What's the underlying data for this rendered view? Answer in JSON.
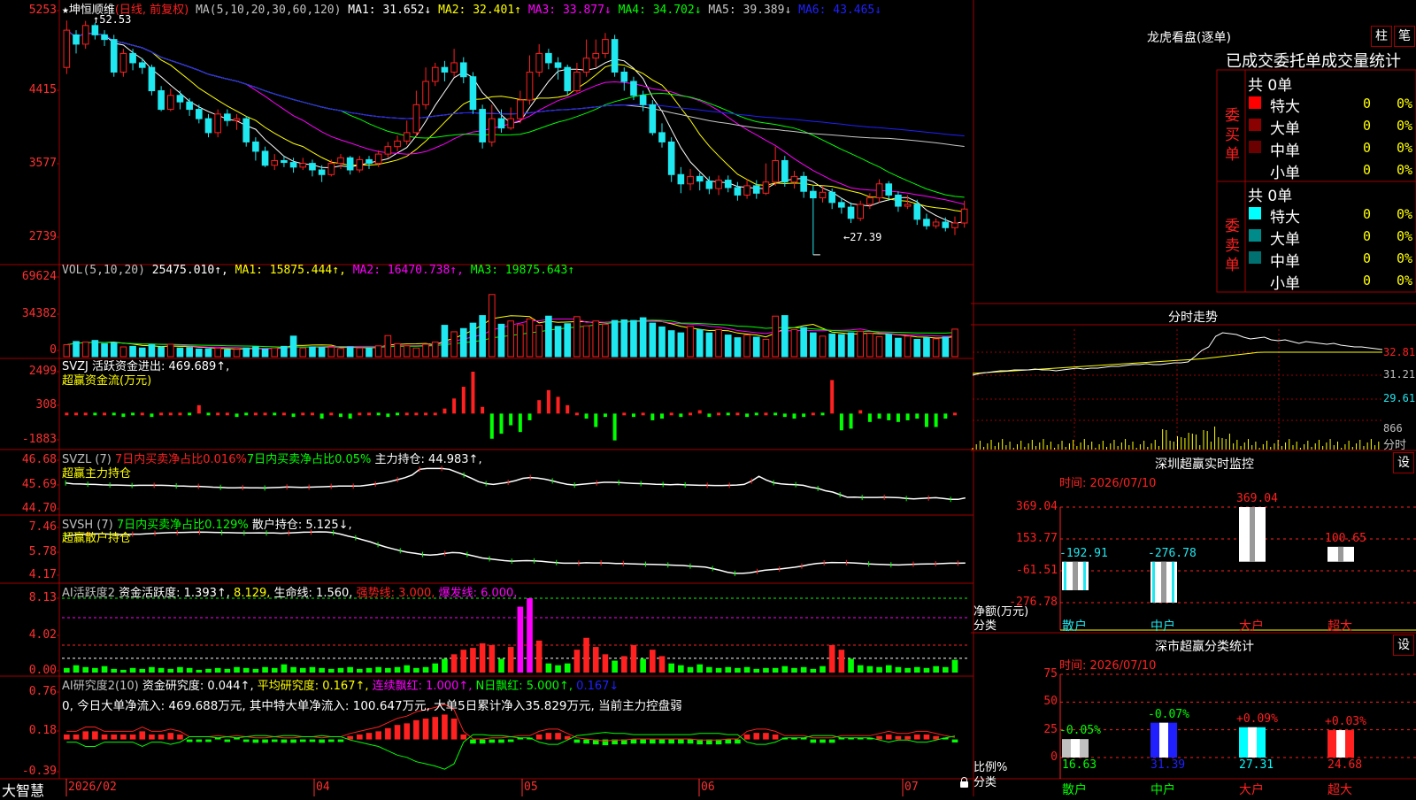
{
  "colors": {
    "up": "#ff2020",
    "down": "#20e8f0",
    "ma1": "#ffffff",
    "ma2": "#ffff00",
    "ma3": "#ff00ff",
    "ma4": "#00ff00",
    "ma5": "#c8c8c8",
    "ma6": "#2020ff",
    "grid": "#a00000"
  },
  "stock": {
    "title_star": "★",
    "name": "坤恒顺维",
    "mode": "(日线, 前复权)",
    "ma_params": "MA(5,10,20,30,60,120)",
    "ma": [
      {
        "label": "MA1:",
        "value": "31.652↓",
        "color": "#ffffff"
      },
      {
        "label": "MA2:",
        "value": "32.401↑",
        "color": "#ffff00"
      },
      {
        "label": "MA3:",
        "value": "33.877↓",
        "color": "#ff00ff"
      },
      {
        "label": "MA4:",
        "value": "34.702↓",
        "color": "#00ff00"
      },
      {
        "label": "MA5:",
        "value": "39.389↓",
        "color": "#c8c8c8"
      },
      {
        "label": "MA6:",
        "value": "43.465↓",
        "color": "#2020ff"
      }
    ],
    "high_mark": "52.53",
    "low_mark": "←27.39"
  },
  "axes": {
    "price": [
      "5253",
      "4415",
      "3577",
      "2739"
    ],
    "vol": [
      "69624",
      "34382",
      "0"
    ],
    "svzj": [
      "2499",
      "308",
      "-1883"
    ],
    "svzl": [
      "46.68",
      "45.69",
      "44.70"
    ],
    "svsh": [
      "7.46",
      "5.78",
      "4.17"
    ],
    "ai_act": [
      "8.13",
      "4.02",
      "0.00"
    ],
    "ai_res": [
      "0.76",
      "0.18",
      "-0.39"
    ]
  },
  "vol_panel": {
    "prefix": "VOL(5,10,20)",
    "value": "25475.010↑,",
    "ma1": "MA1: 15875.444↑,",
    "ma2": "MA2: 16470.738↑,",
    "ma3": "MA3: 19875.643↑"
  },
  "svzj_panel": {
    "line1": "SVZJ  活跃资金进出: 469.689↑,",
    "line2": "超赢资金流(万元)"
  },
  "svzl_panel": {
    "prefix": "SVZL (7)",
    "p1": "7日内买卖净占比0.016%",
    "p2": "7日内买卖净占比0.05%",
    "p3": "主力持仓: 44.983↑,",
    "line2": "超赢主力持仓"
  },
  "svsh_panel": {
    "prefix": "SVSH (7)",
    "p1": "7日内买卖净占比0.129%",
    "p2": "散户持仓: 5.125↓,",
    "line2": "超赢散户持仓"
  },
  "ai_act_panel": {
    "prefix": "AI活跃度2",
    "p1": "资金活跃度: 1.393↑,",
    "p2": "8.129,",
    "p3": "生命线: 1.560,",
    "p4": "强势线: 3.000,",
    "p5": "爆发线: 6.000,"
  },
  "ai_res_panel": {
    "prefix": "AI研究度2(10)",
    "p1": "资金研究度: 0.044↑,",
    "p2": "平均研究度: 0.167↑,",
    "p3": "连续飘红: 1.000↑,",
    "p4": "N日飘红: 5.000↑,",
    "p5": "0.167↓",
    "line2": "0, 今日大单净流入: 469.688万元, 其中特大单净流入: 100.647万元, 大单5日累计净入35.829万元, 当前主力控盘弱"
  },
  "bottom": {
    "brand": "大智慧",
    "dates": [
      "2026/02",
      "04",
      "05",
      "06",
      "07"
    ]
  },
  "longhu": {
    "title": "龙虎看盘(逐单)",
    "btn1": "柱",
    "btn2": "笔",
    "subtitle": "已成交委托单成交量统计",
    "buy": {
      "side_label": "委买单",
      "total": "共 0单",
      "rows": [
        {
          "label": "特大",
          "value": "0",
          "pct": "0%",
          "color": "#ff0000"
        },
        {
          "label": "大单",
          "value": "0",
          "pct": "0%",
          "color": "#8b0000"
        },
        {
          "label": "中单",
          "value": "0",
          "pct": "0%",
          "color": "#6b0000"
        },
        {
          "label": "小单",
          "value": "0",
          "pct": "0%",
          "color": ""
        }
      ]
    },
    "sell": {
      "side_label": "委卖单",
      "total": "共 0单",
      "rows": [
        {
          "label": "特大",
          "value": "0",
          "pct": "0%",
          "color": "#00ffff"
        },
        {
          "label": "大单",
          "value": "0",
          "pct": "0%",
          "color": "#008b8b"
        },
        {
          "label": "中单",
          "value": "0",
          "pct": "0%",
          "color": "#007070"
        },
        {
          "label": "小单",
          "value": "0",
          "pct": "0%",
          "color": ""
        }
      ]
    }
  },
  "fenshi": {
    "title": "分时走势",
    "p1": "32.81",
    "p2": "31.21",
    "p3": "29.61",
    "vol": "866",
    "unit": "分时"
  },
  "shenzhen": {
    "title": "深圳超赢实时监控",
    "btn": "设",
    "time": "时间: 2026/07/10",
    "axis": [
      "369.04",
      "153.77",
      "-61.51",
      "-276.78"
    ],
    "ylabel1": "净额(万元)",
    "ylabel2": "分类",
    "bars": [
      {
        "cat": "散户",
        "value": -192.91,
        "label": "-192.91"
      },
      {
        "cat": "中户",
        "value": -276.78,
        "label": "-276.78"
      },
      {
        "cat": "大户",
        "value": 369.04,
        "label": "369.04"
      },
      {
        "cat": "超大",
        "value": 100.65,
        "label": "100.65"
      }
    ]
  },
  "shenshi": {
    "title": "深市超赢分类统计",
    "btn": "设",
    "time": "时间: 2026/07/10",
    "axis": [
      "75",
      "50",
      "25",
      "0"
    ],
    "ylabel1": "比例%",
    "ylabel2": "分类",
    "bars": [
      {
        "cat": "散户",
        "value": 16.63,
        "label": "16.63",
        "change": "-0.05%",
        "color": "#c0c0c0"
      },
      {
        "cat": "中户",
        "value": 31.39,
        "label": "31.39",
        "change": "-0.07%",
        "color": "#2020ff"
      },
      {
        "cat": "大户",
        "value": 27.31,
        "label": "27.31",
        "change": "+0.09%",
        "color": "#00ffff"
      },
      {
        "cat": "超大",
        "value": 24.68,
        "label": "24.68",
        "change": "+0.03%",
        "color": "#ff2020"
      }
    ]
  },
  "chart_data": {
    "type": "candlestick",
    "price_range": [
      27.39,
      52.53
    ],
    "candles": [
      [
        47.5,
        51.5,
        52.53,
        46.8
      ],
      [
        51.0,
        50.0,
        51.5,
        49.0
      ],
      [
        50.0,
        52.0,
        52.5,
        49.5
      ],
      [
        52.0,
        51.0,
        52.3,
        50.5
      ],
      [
        51.0,
        50.5,
        51.5,
        49.8
      ],
      [
        50.5,
        47.0,
        51.0,
        46.5
      ],
      [
        47.0,
        49.0,
        49.5,
        46.5
      ],
      [
        49.0,
        48.0,
        49.5,
        47.2
      ],
      [
        48.0,
        47.5,
        48.5,
        46.8
      ],
      [
        47.5,
        45.0,
        47.8,
        44.5
      ],
      [
        45.0,
        43.0,
        45.5,
        42.8
      ],
      [
        43.0,
        44.5,
        45.2,
        42.8
      ],
      [
        44.5,
        43.8,
        45.0,
        43.0
      ],
      [
        43.8,
        43.0,
        44.2,
        42.3
      ],
      [
        43.0,
        42.0,
        43.5,
        41.5
      ],
      [
        42.0,
        40.5,
        42.5,
        40.0
      ],
      [
        40.5,
        42.5,
        43.0,
        40.0
      ],
      [
        42.5,
        41.8,
        43.0,
        41.2
      ],
      [
        41.8,
        42.0,
        42.5,
        40.8
      ],
      [
        42.0,
        39.5,
        42.3,
        39.0
      ],
      [
        39.5,
        38.5,
        40.0,
        37.5
      ],
      [
        38.5,
        37.0,
        39.0,
        36.8
      ],
      [
        37.0,
        37.5,
        38.2,
        36.5
      ],
      [
        37.5,
        37.3,
        38.0,
        36.8
      ],
      [
        37.3,
        36.8,
        37.8,
        36.2
      ],
      [
        36.8,
        37.2,
        37.8,
        36.5
      ],
      [
        37.2,
        36.5,
        37.6,
        35.8
      ],
      [
        36.5,
        36.0,
        37.0,
        35.2
      ],
      [
        36.0,
        37.2,
        37.6,
        35.8
      ],
      [
        37.2,
        37.8,
        38.2,
        36.6
      ],
      [
        37.8,
        36.5,
        38.0,
        36.0
      ],
      [
        36.5,
        37.6,
        38.0,
        36.2
      ],
      [
        37.6,
        37.2,
        38.0,
        36.6
      ],
      [
        37.2,
        38.2,
        38.6,
        36.8
      ],
      [
        38.2,
        39.0,
        39.5,
        37.8
      ],
      [
        39.0,
        39.6,
        40.2,
        38.5
      ],
      [
        39.6,
        40.5,
        41.8,
        39.2
      ],
      [
        40.5,
        43.5,
        45.0,
        40.0
      ],
      [
        43.5,
        46.0,
        47.5,
        43.0
      ],
      [
        46.0,
        47.5,
        48.0,
        45.5
      ],
      [
        47.5,
        47.0,
        48.2,
        46.0
      ],
      [
        47.0,
        48.0,
        49.5,
        46.5
      ],
      [
        48.0,
        46.5,
        48.6,
        45.8
      ],
      [
        46.5,
        43.0,
        47.0,
        42.5
      ],
      [
        43.0,
        39.5,
        43.5,
        38.8
      ],
      [
        39.5,
        42.0,
        43.5,
        39.0
      ],
      [
        42.0,
        41.0,
        43.0,
        40.5
      ],
      [
        41.0,
        42.0,
        43.2,
        40.8
      ],
      [
        42.0,
        44.0,
        45.0,
        41.5
      ],
      [
        44.0,
        47.0,
        48.8,
        43.5
      ],
      [
        47.0,
        49.0,
        50.0,
        46.5
      ],
      [
        49.0,
        48.0,
        49.5,
        47.3
      ],
      [
        48.0,
        47.5,
        48.6,
        46.2
      ],
      [
        47.5,
        45.0,
        47.8,
        44.5
      ],
      [
        45.0,
        47.0,
        48.0,
        44.8
      ],
      [
        47.0,
        48.5,
        50.5,
        46.5
      ],
      [
        48.5,
        49.0,
        50.5,
        47.5
      ],
      [
        49.0,
        50.5,
        51.2,
        48.5
      ],
      [
        50.5,
        47.0,
        51.0,
        46.5
      ],
      [
        47.0,
        46.0,
        47.5,
        45.0
      ],
      [
        46.0,
        44.5,
        46.5,
        44.0
      ],
      [
        44.5,
        43.5,
        45.0,
        42.8
      ],
      [
        43.5,
        40.5,
        44.0,
        40.2
      ],
      [
        40.5,
        39.5,
        41.5,
        38.9
      ],
      [
        39.5,
        36.0,
        40.0,
        35.2
      ],
      [
        36.0,
        35.0,
        36.8,
        34.0
      ],
      [
        35.0,
        35.8,
        36.6,
        34.3
      ],
      [
        35.8,
        35.3,
        36.2,
        34.3
      ],
      [
        35.3,
        34.5,
        35.8,
        33.9
      ],
      [
        34.5,
        35.4,
        35.9,
        33.8
      ],
      [
        35.4,
        34.6,
        35.9,
        34.1
      ],
      [
        34.6,
        33.8,
        35.2,
        33.2
      ],
      [
        33.8,
        34.8,
        35.5,
        33.4
      ],
      [
        34.8,
        34.0,
        35.4,
        33.4
      ],
      [
        34.0,
        35.2,
        37.2,
        33.8
      ],
      [
        35.2,
        37.5,
        39.0,
        34.8
      ],
      [
        37.5,
        35.2,
        38.0,
        34.7
      ],
      [
        35.2,
        35.8,
        36.4,
        34.5
      ],
      [
        35.8,
        34.2,
        36.3,
        33.5
      ],
      [
        34.2,
        33.5,
        34.8,
        27.39
      ],
      [
        33.5,
        34.1,
        34.8,
        33.0
      ],
      [
        34.1,
        33.0,
        34.5,
        32.3
      ],
      [
        33.0,
        32.5,
        33.5,
        31.8
      ],
      [
        32.5,
        31.3,
        33.0,
        30.8
      ],
      [
        31.3,
        32.8,
        33.2,
        31.0
      ],
      [
        32.8,
        33.5,
        34.0,
        32.3
      ],
      [
        33.5,
        35.0,
        35.5,
        33.0
      ],
      [
        35.0,
        33.8,
        35.3,
        33.2
      ],
      [
        33.8,
        32.6,
        34.2,
        32.0
      ],
      [
        32.6,
        32.8,
        33.8,
        32.3
      ],
      [
        32.8,
        31.2,
        33.3,
        30.6
      ],
      [
        31.2,
        30.5,
        31.8,
        30.1
      ],
      [
        30.5,
        30.9,
        31.3,
        30.2
      ],
      [
        30.9,
        30.3,
        31.4,
        29.9
      ],
      [
        30.3,
        30.8,
        31.5,
        29.5
      ],
      [
        30.8,
        32.3,
        33.2,
        30.3
      ]
    ],
    "volume": [
      11000,
      14000,
      13500,
      15000,
      12000,
      13000,
      9000,
      9500,
      8000,
      11000,
      9000,
      11500,
      8000,
      8500,
      7000,
      7200,
      7800,
      6500,
      6800,
      8000,
      9000,
      7000,
      8000,
      9500,
      19000,
      8000,
      9000,
      8500,
      8800,
      7500,
      9000,
      8000,
      7600,
      10000,
      19500,
      12000,
      10000,
      8000,
      11500,
      13500,
      29000,
      23000,
      26000,
      31000,
      38000,
      57500,
      30000,
      33000,
      29500,
      35000,
      29000,
      37500,
      28000,
      30500,
      37000,
      28500,
      33000,
      30000,
      33500,
      34000,
      33500,
      36000,
      31000,
      27500,
      24000,
      22000,
      28000,
      25000,
      22000,
      25000,
      20000,
      17500,
      20000,
      18000,
      16000,
      37500,
      38000,
      25000,
      27000,
      22000,
      19000,
      21000,
      20500,
      22000,
      23500,
      21500,
      18500,
      20500,
      17000,
      19000,
      16000,
      17500,
      16500,
      18000,
      25475
    ],
    "svzj": [
      0,
      0,
      100,
      -100,
      0,
      -100,
      -200,
      -100,
      0,
      -200,
      0,
      0,
      100,
      -100,
      500,
      -100,
      0,
      0,
      -200,
      -100,
      0,
      0,
      -100,
      0,
      -200,
      0,
      100,
      -300,
      0,
      -200,
      -300,
      0,
      0,
      -100,
      -200,
      -100,
      0,
      0,
      100,
      0,
      300,
      900,
      1600,
      2499,
      400,
      -1500,
      -1200,
      -700,
      -1100,
      -400,
      800,
      1400,
      1000,
      500,
      0,
      -300,
      -800,
      -200,
      -1600,
      0,
      -200,
      100,
      -400,
      -300,
      0,
      -200,
      0,
      200,
      -200,
      0,
      -100,
      0,
      -200,
      -100,
      0,
      -100,
      -200,
      -300,
      -200,
      0,
      -100,
      2000,
      -1000,
      -900,
      200,
      -500,
      -300,
      -400,
      -500,
      -400,
      -300,
      -800,
      -800,
      -300,
      0
    ],
    "svzl": [
      45.89,
      45.85,
      45.84,
      45.83,
      45.82,
      45.8,
      45.79,
      45.79,
      45.78,
      45.77,
      45.78,
      45.78,
      45.78,
      45.78,
      45.77,
      45.75,
      45.74,
      45.73,
      45.73,
      45.71,
      45.69,
      45.68,
      45.66,
      45.66,
      45.67,
      45.66,
      45.66,
      45.65,
      45.67,
      45.68,
      45.7,
      45.69,
      45.68,
      45.69,
      45.7,
      45.71,
      45.73,
      45.74,
      45.74,
      45.74,
      45.75,
      45.79,
      45.84,
      45.89,
      45.96,
      46.05,
      46.14,
      46.27,
      46.54,
      46.58,
      46.58,
      46.58,
      46.54,
      46.41,
      46.27,
      46.12,
      45.95,
      45.86,
      45.82,
      45.87,
      45.92,
      46.0,
      46.11,
      46.15,
      46.12,
      46.07,
      45.99,
      45.9,
      45.83,
      45.79,
      45.83,
      45.86,
      45.89,
      45.92,
      45.92,
      45.91,
      45.89,
      45.87,
      45.86,
      45.85,
      45.83,
      45.82,
      45.81,
      45.82,
      45.8,
      45.79,
      45.78,
      45.78,
      45.77,
      45.77,
      45.78,
      45.79,
      45.82,
      45.98,
      46.21,
      46.03,
      45.9,
      45.85,
      45.82,
      45.81,
      45.78,
      45.69,
      45.63,
      45.52,
      45.46,
      45.33,
      45.21,
      45.22,
      45.2,
      45.2,
      45.2,
      45.21,
      45.2,
      45.19,
      45.15,
      45.13,
      45.15,
      45.17,
      45.19,
      45.15,
      45.11,
      45.11,
      45.18
    ],
    "svsh": [
      7.0,
      7.05,
      7.1,
      7.12,
      7.14,
      7.14,
      7.12,
      7.1,
      7.1,
      7.12,
      7.12,
      7.15,
      7.18,
      7.2,
      7.22,
      7.23,
      7.24,
      7.25,
      7.26,
      7.25,
      7.24,
      7.23,
      7.22,
      7.21,
      7.2,
      7.2,
      7.21,
      7.2,
      7.2,
      7.18,
      7.2,
      7.22,
      7.25,
      7.26,
      7.28,
      7.27,
      7.22,
      7.12,
      6.98,
      6.87,
      6.72,
      6.58,
      6.4,
      6.24,
      6.11,
      5.98,
      5.87,
      5.8,
      5.72,
      5.68,
      5.72,
      5.79,
      5.85,
      5.83,
      5.72,
      5.6,
      5.48,
      5.42,
      5.36,
      5.3,
      5.26,
      5.28,
      5.3,
      5.28,
      5.25,
      5.2,
      5.16,
      5.12,
      5.12,
      5.12,
      5.15,
      5.14,
      5.14,
      5.13,
      5.1,
      5.1,
      5.08,
      5.06,
      5.05,
      5.04,
      5.02,
      5.0,
      4.98,
      4.96,
      4.92,
      4.89,
      4.85,
      4.75,
      4.63,
      4.5,
      4.42,
      4.42,
      4.46,
      4.55,
      4.63,
      4.68,
      4.72,
      4.78,
      4.84,
      4.92,
      5.02,
      5.1,
      5.14,
      5.17,
      5.16,
      5.16,
      5.14,
      5.11,
      5.07,
      5.05,
      5.03,
      5.01,
      5.0,
      5.02,
      5.05,
      5.06,
      5.07,
      5.08,
      5.1,
      5.12,
      5.12,
      5.125
    ],
    "ai_act": [
      0.5,
      0.8,
      0.6,
      0.5,
      0.7,
      0.4,
      0.3,
      0.5,
      0.4,
      0.6,
      0.5,
      0.4,
      0.6,
      0.5,
      0.3,
      0.4,
      0.5,
      0.4,
      0.6,
      0.5,
      0.4,
      0.6,
      0.5,
      0.9,
      0.6,
      0.5,
      0.6,
      0.5,
      0.4,
      0.5,
      0.6,
      0.4,
      0.5,
      0.6,
      0.5,
      0.6,
      0.8,
      0.5,
      0.6,
      1.0,
      1.5,
      2.0,
      2.5,
      2.7,
      3.2,
      3.0,
      1.5,
      2.8,
      7.2,
      8.13,
      3.5,
      1.0,
      0.8,
      1.0,
      2.5,
      3.8,
      2.8,
      2.0,
      1.3,
      1.8,
      3.0,
      1.5,
      2.5,
      1.8,
      1.0,
      0.8,
      0.6,
      0.9,
      0.6,
      0.5,
      0.6,
      0.5,
      0.6,
      0.4,
      0.5,
      0.5,
      0.7,
      0.5,
      0.6,
      0.4,
      0.7,
      3.0,
      2.5,
      1.5,
      0.8,
      0.7,
      0.6,
      0.8,
      0.6,
      0.5,
      0.6,
      0.5,
      0.7,
      0.6,
      1.393
    ],
    "ai_res": [
      0.1,
      0.1,
      0.14,
      0.14,
      0.1,
      0.1,
      0.1,
      0.1,
      0.14,
      0.1,
      0.1,
      0.12,
      0.1,
      0.05,
      0.05,
      0.05,
      0.06,
      0.05,
      0.06,
      0.05,
      0.04,
      0.04,
      0.05,
      0.04,
      0.04,
      0.05,
      0.05,
      0.04,
      0.05,
      0.05,
      0.08,
      0.1,
      0.12,
      0.14,
      0.18,
      0.22,
      0.24,
      0.28,
      0.3,
      0.32,
      0.35,
      0.3,
      0.1,
      0.03,
      0.03,
      0.04,
      0.04,
      0.05,
      0.06,
      0.06,
      0.1,
      0.12,
      0.12,
      0.08,
      0.04,
      0.03,
      0.02,
      0.01,
      0.02,
      0.02,
      0.03,
      0.03,
      0.03,
      0.03,
      0.03,
      0.03,
      0.03,
      0.02,
      0.02,
      0.02,
      0.03,
      0.03,
      0.1,
      0.12,
      0.12,
      0.1,
      0.06,
      0.06,
      0.06,
      0.04,
      0.04,
      0.04,
      0.06,
      0.06,
      0.06,
      0.06,
      0.08,
      0.1,
      0.08,
      0.08,
      0.1,
      0.1,
      0.08,
      0.06,
      0.044
    ]
  }
}
